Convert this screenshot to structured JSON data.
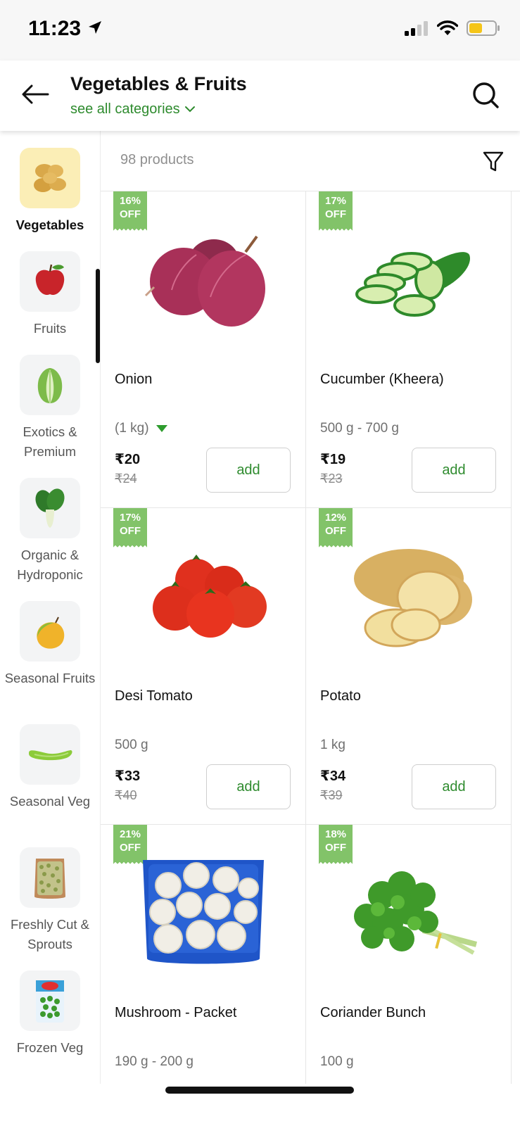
{
  "status_bar": {
    "time": "11:23",
    "battery_color": "#f5c518"
  },
  "header": {
    "title": "Vegetables & Fruits",
    "subtitle": "see all categories",
    "accent_color": "#2e8b2e"
  },
  "sidebar": {
    "items": [
      {
        "label": "Vegetables",
        "icon": "potato-icon",
        "active": true
      },
      {
        "label": "Fruits",
        "icon": "apple-icon",
        "active": false
      },
      {
        "label": "Exotics & Premium",
        "icon": "lettuce-icon",
        "active": false
      },
      {
        "label": "Organic & Hydroponic",
        "icon": "bok-choy-icon",
        "active": false
      },
      {
        "label": "Seasonal Fruits",
        "icon": "mango-icon",
        "active": false
      },
      {
        "label": "Seasonal Veg",
        "icon": "gourd-icon",
        "active": false
      },
      {
        "label": "Freshly Cut & Sprouts",
        "icon": "sprouts-icon",
        "active": false
      },
      {
        "label": "Frozen Veg",
        "icon": "frozen-peas-icon",
        "active": false
      }
    ]
  },
  "products_bar": {
    "count_text": "98 products"
  },
  "products": [
    {
      "name": "Onion",
      "qty": "(1 kg)",
      "has_variants": true,
      "price": "₹20",
      "mrp": "₹24",
      "discount_pct": "16%",
      "discount_word": "OFF",
      "add_label": "add",
      "image": "onion-icon"
    },
    {
      "name": "Cucumber (Kheera)",
      "qty": "500 g - 700 g",
      "has_variants": false,
      "price": "₹19",
      "mrp": "₹23",
      "discount_pct": "17%",
      "discount_word": "OFF",
      "add_label": "add",
      "image": "cucumber-icon"
    },
    {
      "name": "Desi Tomato",
      "qty": "500 g",
      "has_variants": false,
      "price": "₹33",
      "mrp": "₹40",
      "discount_pct": "17%",
      "discount_word": "OFF",
      "add_label": "add",
      "image": "tomato-icon"
    },
    {
      "name": "Potato",
      "qty": "1 kg",
      "has_variants": false,
      "price": "₹34",
      "mrp": "₹39",
      "discount_pct": "12%",
      "discount_word": "OFF",
      "add_label": "add",
      "image": "potato-icon"
    },
    {
      "name": "Mushroom - Packet",
      "qty": "190 g - 200 g",
      "has_variants": false,
      "price": "",
      "mrp": "",
      "discount_pct": "21%",
      "discount_word": "OFF",
      "add_label": "",
      "image": "mushroom-icon"
    },
    {
      "name": "Coriander Bunch",
      "qty": "100 g",
      "has_variants": false,
      "price": "",
      "mrp": "",
      "discount_pct": "18%",
      "discount_word": "OFF",
      "add_label": "",
      "image": "coriander-icon"
    }
  ]
}
